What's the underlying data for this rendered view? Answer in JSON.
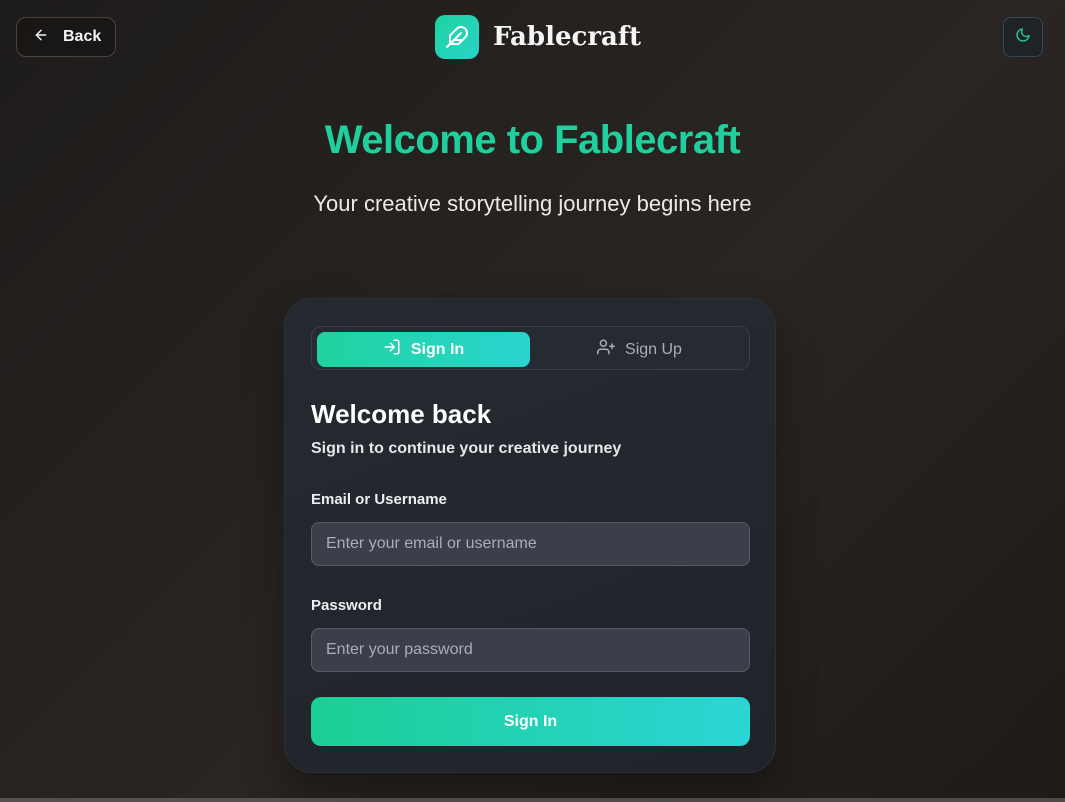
{
  "header": {
    "back_label": "Back",
    "brand_name": "Fablecraft",
    "icons": {
      "back": "arrow-left-icon",
      "logo": "feather-icon",
      "theme": "moon-icon"
    }
  },
  "hero": {
    "title": "Welcome to Fablecraft",
    "subtitle": "Your creative storytelling journey begins here"
  },
  "auth": {
    "tabs": [
      {
        "label": "Sign In",
        "icon": "log-in-icon",
        "active": true
      },
      {
        "label": "Sign Up",
        "icon": "user-plus-icon",
        "active": false
      }
    ],
    "title": "Welcome back",
    "subtitle": "Sign in to continue your creative journey",
    "email_label": "Email or Username",
    "email_placeholder": "Enter your email or username",
    "email_value": "",
    "password_label": "Password",
    "password_placeholder": "Enter your password",
    "password_value": "",
    "submit_label": "Sign In"
  },
  "colors": {
    "accent": "#1fcf9e",
    "accent_gradient_end": "#2ad4d0",
    "background": "#221f1d",
    "card": "#23272e"
  }
}
